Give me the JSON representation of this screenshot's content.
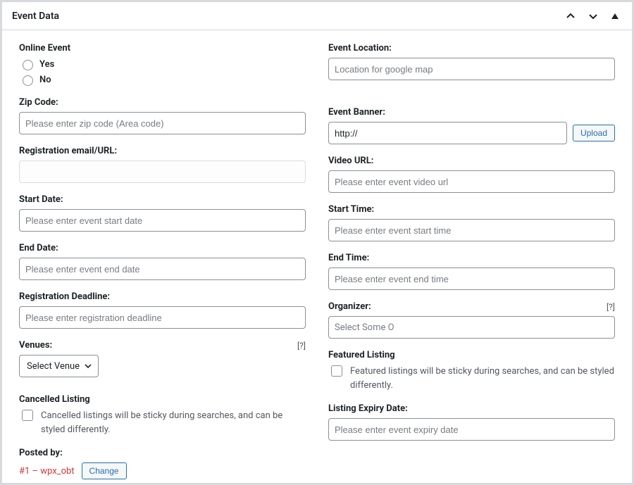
{
  "panel": {
    "title": "Event Data"
  },
  "left": {
    "online_label": "Online Event",
    "yes_label": "Yes",
    "no_label": "No",
    "zip_label": "Zip Code:",
    "zip_placeholder": "Please enter zip code (Area code)",
    "reg_label": "Registration email/URL:",
    "reg_value": "",
    "start_date_label": "Start Date:",
    "start_date_placeholder": "Please enter event start date",
    "end_date_label": "End Date:",
    "end_date_placeholder": "Please enter event end date",
    "deadline_label": "Registration Deadline:",
    "deadline_placeholder": "Please enter registration deadline",
    "venues_label": "Venues:",
    "venues_help": "[?]",
    "venues_select": "Select Venue",
    "cancelled_label": "Cancelled Listing",
    "cancelled_text": "Cancelled listings will be sticky during searches, and can be styled differently.",
    "posted_label": "Posted by:",
    "posted_value": "#1 – wpx_obt",
    "change_button": "Change"
  },
  "right": {
    "location_label": "Event Location:",
    "location_placeholder": "Location for google map",
    "banner_label": "Event Banner:",
    "banner_value": "http://",
    "upload_button": "Upload",
    "video_label": "Video URL:",
    "video_placeholder": "Please enter event video url",
    "start_time_label": "Start Time:",
    "start_time_placeholder": "Please enter event start time",
    "end_time_label": "End Time:",
    "end_time_placeholder": "Please enter event end time",
    "organizer_label": "Organizer:",
    "organizer_help": "[?]",
    "organizer_select": "Select Some O",
    "featured_label": "Featured Listing",
    "featured_text": "Featured listings will be sticky during searches, and can be styled differently.",
    "expiry_label": "Listing Expiry Date:",
    "expiry_placeholder": "Please enter event expiry date"
  }
}
